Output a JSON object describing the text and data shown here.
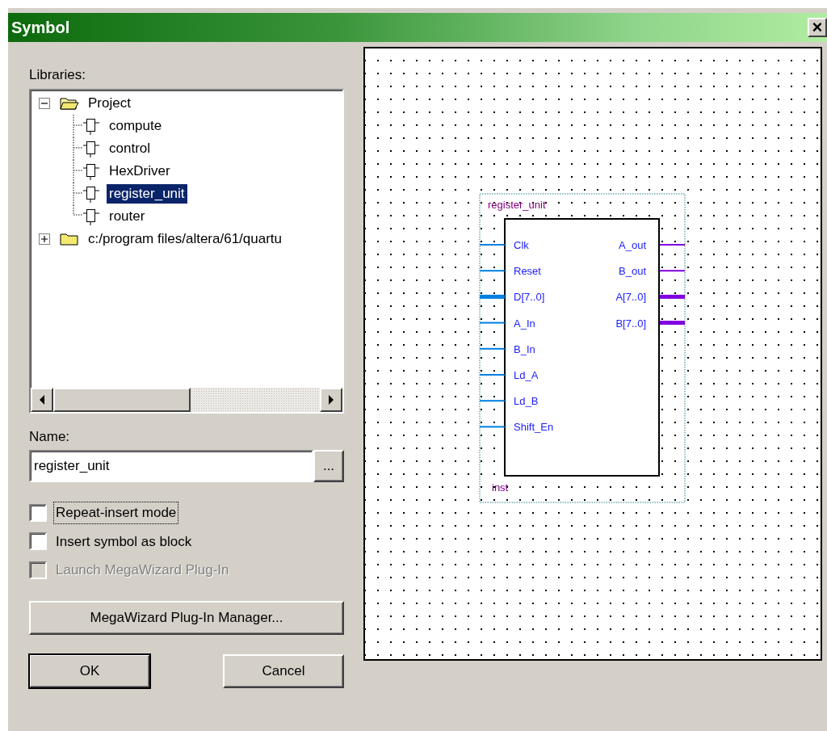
{
  "window": {
    "title": "Symbol",
    "close_label": "×"
  },
  "libraries": {
    "label": "Libraries:",
    "tree": [
      {
        "label": "Project",
        "kind": "folder",
        "expanded": true,
        "selected": false,
        "children": [
          {
            "label": "compute",
            "kind": "symbol",
            "selected": false
          },
          {
            "label": "control",
            "kind": "symbol",
            "selected": false
          },
          {
            "label": "HexDriver",
            "kind": "symbol",
            "selected": false
          },
          {
            "label": "register_unit",
            "kind": "symbol",
            "selected": true
          },
          {
            "label": "router",
            "kind": "symbol",
            "selected": false
          }
        ]
      },
      {
        "label": "c:/program files/altera/61/quartu",
        "kind": "folder",
        "expanded": false,
        "selected": false
      }
    ]
  },
  "name": {
    "label": "Name:",
    "value": "register_unit",
    "browse_label": "..."
  },
  "options": [
    {
      "label": "Repeat-insert mode",
      "checked": false,
      "disabled": false,
      "focused": true
    },
    {
      "label": "Insert symbol as block",
      "checked": false,
      "disabled": false,
      "focused": false
    },
    {
      "label": "Launch MegaWizard Plug-In",
      "checked": false,
      "disabled": true,
      "focused": false
    }
  ],
  "megawizard_button": "MegaWizard Plug-In Manager...",
  "buttons": [
    {
      "label": "OK",
      "default": true
    },
    {
      "label": "Cancel",
      "default": false
    }
  ],
  "symbol": {
    "name": "register_unit",
    "instance": "inst",
    "inputs": [
      {
        "label": "Clk",
        "bus": false
      },
      {
        "label": "Reset",
        "bus": false
      },
      {
        "label": "D[7..0]",
        "bus": true
      },
      {
        "label": "A_In",
        "bus": false
      },
      {
        "label": "B_In",
        "bus": false
      },
      {
        "label": "Ld_A",
        "bus": false
      },
      {
        "label": "Ld_B",
        "bus": false
      },
      {
        "label": "Shift_En",
        "bus": false
      }
    ],
    "outputs": [
      {
        "label": "A_out",
        "bus": false
      },
      {
        "label": "B_out",
        "bus": false
      },
      {
        "label": "A[7..0]",
        "bus": true
      },
      {
        "label": "B[7..0]",
        "bus": true
      }
    ]
  }
}
